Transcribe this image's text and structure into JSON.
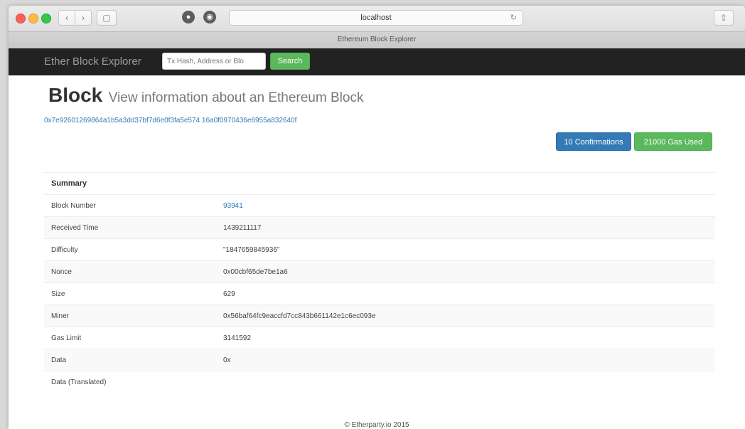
{
  "browser": {
    "address": "localhost",
    "tab_title": "Ethereum Block Explorer"
  },
  "navbar": {
    "brand": "Ether Block Explorer",
    "search_placeholder": "Tx Hash, Address or Blo",
    "search_label": "Search"
  },
  "page": {
    "title": "Block",
    "subtitle": "View information about an Ethereum Block",
    "block_hash": "0x7e92601269864a1b5a3dd37bf7d6e0f3fa5e574 16a0f0970436e6955a832640f",
    "confirmations_label": "10 Confirmations",
    "gas_used_label": "21000 Gas Used"
  },
  "summary": {
    "heading": "Summary",
    "rows": [
      {
        "label": "Block Number",
        "value": "93941"
      },
      {
        "label": "Received Time",
        "value": "1439211117"
      },
      {
        "label": "Difficulty",
        "value": "\"1847659845936\""
      },
      {
        "label": "Nonce",
        "value": "0x00cbf65de7be1a6"
      },
      {
        "label": "Size",
        "value": "629"
      },
      {
        "label": "Miner",
        "value": "0x56baf64fc9eaccfd7cc843b661142e1c6ec093e"
      },
      {
        "label": "Gas Limit",
        "value": "3141592"
      },
      {
        "label": "Data",
        "value": "0x"
      },
      {
        "label": "Data (Translated)",
        "value": ""
      }
    ]
  },
  "footer": {
    "copyright": "© Etherparty.io 2015"
  },
  "colors": {
    "navbar_bg": "#222222",
    "primary": "#337ab7",
    "success": "#5cb85c"
  }
}
